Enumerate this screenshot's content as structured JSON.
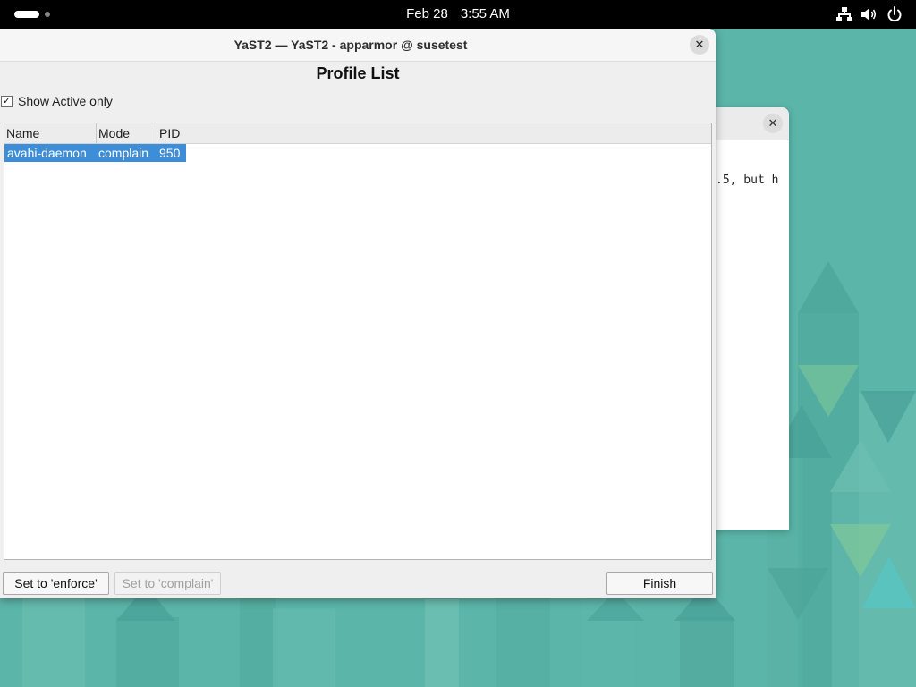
{
  "topbar": {
    "date": "Feb 28",
    "time": "3:55 AM",
    "icons": [
      "network-icon",
      "volume-icon",
      "power-icon"
    ]
  },
  "background_window": {
    "terminal_text": ".5, but h"
  },
  "window": {
    "title": "YaST2 — YaST2 - apparmor @ susetest",
    "close_glyph": "✕",
    "heading": "Profile List",
    "show_active_only": {
      "label": "Show Active only",
      "checked": true,
      "check_glyph": "✓"
    },
    "table": {
      "columns": [
        "Name",
        "Mode",
        "PID"
      ],
      "rows": [
        {
          "name": "avahi-daemon",
          "mode": "complain",
          "pid": "950",
          "selected": true
        }
      ]
    },
    "buttons": {
      "enforce": "Set to 'enforce'",
      "complain": "Set to 'complain'",
      "complain_enabled": false,
      "finish": "Finish"
    }
  },
  "colors": {
    "wallpaper": "#5bb5a9",
    "selection": "#3d8ed6",
    "topbar": "#000000"
  }
}
